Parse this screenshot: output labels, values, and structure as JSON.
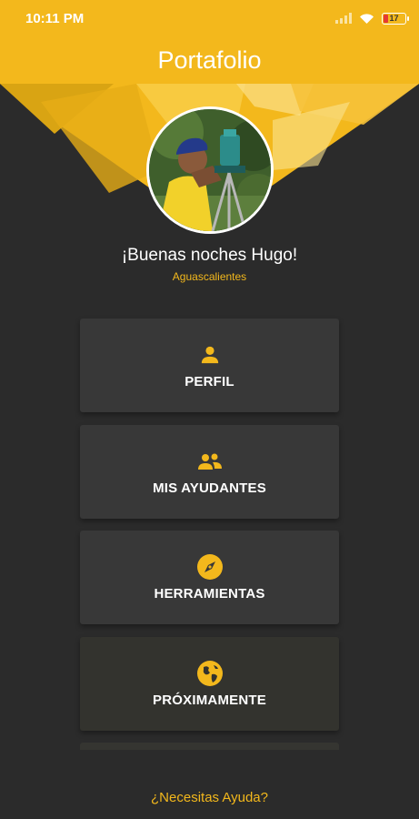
{
  "status_bar": {
    "time": "10:11 PM",
    "battery": "17"
  },
  "app_bar": {
    "title": "Portafolio"
  },
  "profile": {
    "greeting": "¡Buenas noches Hugo!",
    "location": "Aguascalientes"
  },
  "menu": [
    {
      "label": "PERFIL",
      "icon": "person-icon"
    },
    {
      "label": "MIS AYUDANTES",
      "icon": "people-icon"
    },
    {
      "label": "HERRAMIENTAS",
      "icon": "compass-icon"
    },
    {
      "label": "PRÓXIMAMENTE",
      "icon": "globe-icon"
    }
  ],
  "help": {
    "label": "¿Necesitas Ayuda?"
  },
  "colors": {
    "accent": "#f3b81c",
    "background": "#2b2b2b",
    "card": "#383838"
  }
}
